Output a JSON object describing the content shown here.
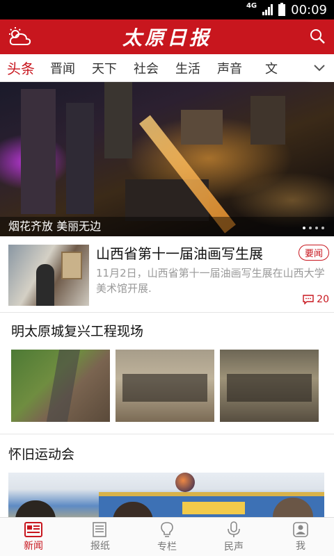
{
  "status": {
    "network": "4G",
    "time": "00:09"
  },
  "header": {
    "logo": "太原日报",
    "weather_icon": "weather-cloud-sun-icon",
    "search_icon": "search-icon"
  },
  "tabs": [
    {
      "label": "头条",
      "active": true
    },
    {
      "label": "晋闻"
    },
    {
      "label": "天下"
    },
    {
      "label": "社会"
    },
    {
      "label": "生活"
    },
    {
      "label": "声音"
    },
    {
      "label": "文"
    }
  ],
  "hero": {
    "caption": "烟花齐放 美丽无边"
  },
  "news": {
    "title": "山西省第十一届油画写生展",
    "summary": "11月2日，山西省第十一届油画写生展在山西大学美术馆开展.",
    "tag": "要闻",
    "comments": "20"
  },
  "gallery": {
    "title": "明太原城复兴工程现场"
  },
  "section2": {
    "title": "怀旧运动会"
  },
  "bottom_nav": [
    {
      "label": "新闻",
      "icon": "news-icon",
      "active": true
    },
    {
      "label": "报纸",
      "icon": "newspaper-icon"
    },
    {
      "label": "专栏",
      "icon": "lightbulb-icon"
    },
    {
      "label": "民声",
      "icon": "microphone-icon"
    },
    {
      "label": "我",
      "icon": "user-icon"
    }
  ],
  "colors": {
    "brand": "#c8161e"
  }
}
